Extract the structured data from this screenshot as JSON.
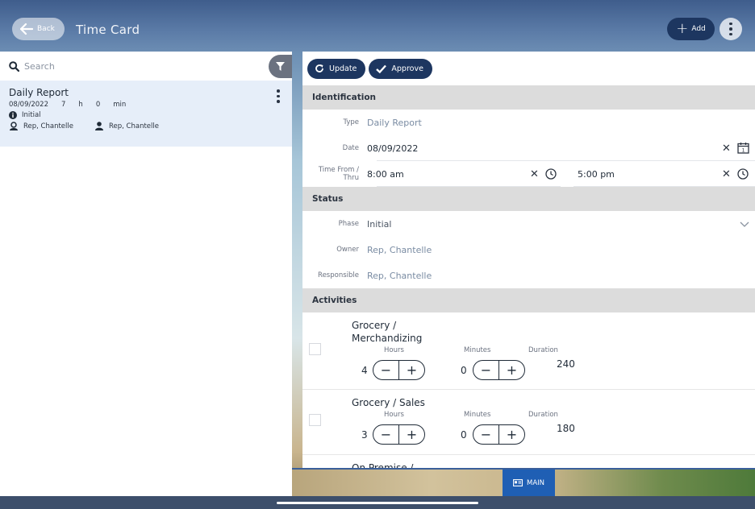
{
  "header": {
    "back_label": "Back",
    "title": "Time Card",
    "add_label": "Add"
  },
  "search": {
    "placeholder": "Search"
  },
  "list": {
    "items": [
      {
        "name": "Daily Report",
        "date": "08/09/2022",
        "hours": "7",
        "h": "h",
        "minutes": "0",
        "min": "min",
        "phase": "Initial",
        "owner": "Rep, Chantelle",
        "responsible": "Rep, Chantelle"
      }
    ]
  },
  "actions": {
    "update_label": "Update",
    "approve_label": "Approve"
  },
  "identification": {
    "section_label": "Identification",
    "type_label": "Type",
    "type_value": "Daily Report",
    "date_label": "Date",
    "date_value": "08/09/2022",
    "time_label": "Time From / Thru",
    "time_from": "8:00 am",
    "time_thru": "5:00 pm"
  },
  "status": {
    "section_label": "Status",
    "phase_label": "Phase",
    "phase_value": "Initial",
    "owner_label": "Owner",
    "owner_value": "Rep, Chantelle",
    "responsible_label": "Responsible",
    "responsible_value": "Rep, Chantelle"
  },
  "activities": {
    "section_label": "Activities",
    "hours_label": "Hours",
    "minutes_label": "Minutes",
    "duration_label": "Duration",
    "items": [
      {
        "name_line1": "Grocery /",
        "name_line2": "Merchandizing",
        "hours": "4",
        "minutes": "0",
        "duration": "240"
      },
      {
        "name_line1": "Grocery / Sales",
        "name_line2": "",
        "hours": "3",
        "minutes": "0",
        "duration": "180"
      },
      {
        "name_line1": "On Premise /",
        "name_line2": "",
        "hours": "",
        "minutes": "",
        "duration": ""
      }
    ]
  },
  "bottom": {
    "main_label": "MAIN"
  },
  "colors": {
    "navy": "#1d3660",
    "selected_row": "#e6eef9",
    "section_bg": "#dcdcdc",
    "tab_blue": "#1f5fb4"
  }
}
